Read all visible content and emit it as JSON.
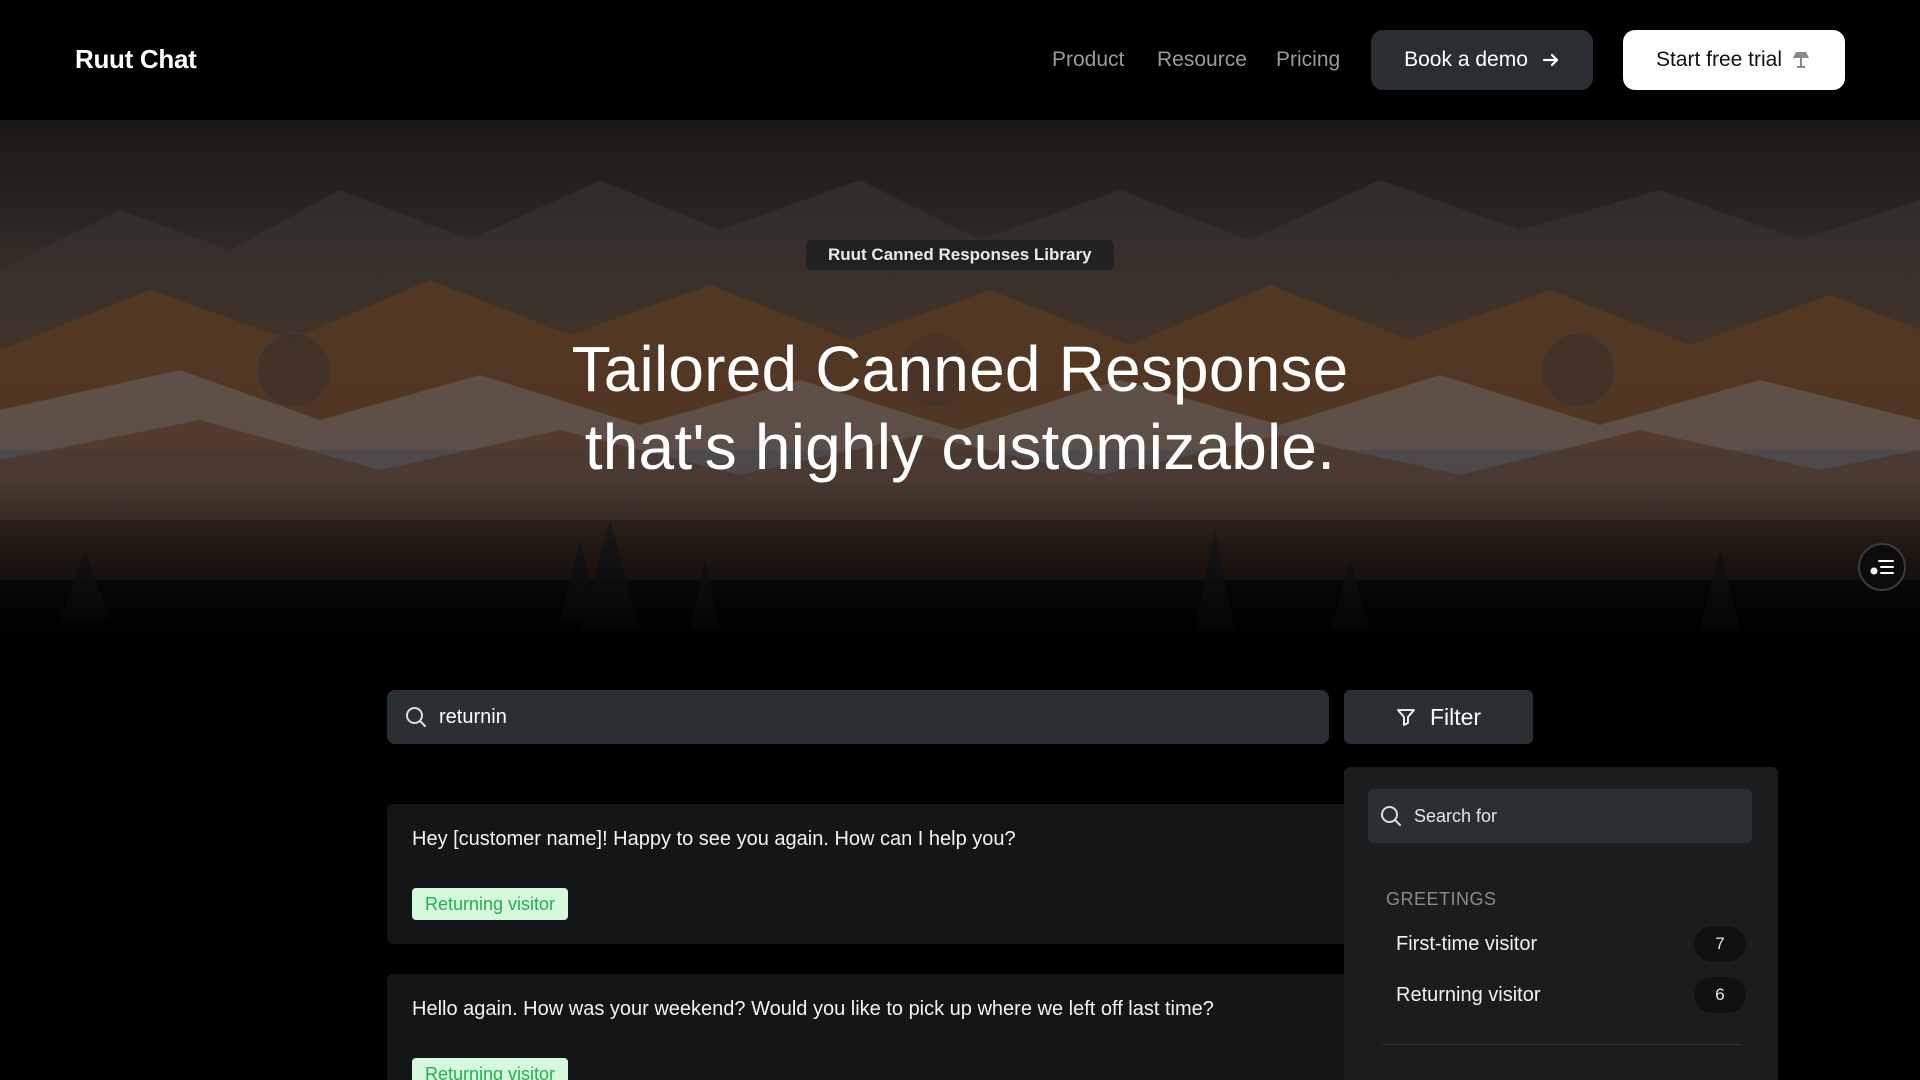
{
  "nav": {
    "brand": "Ruut Chat",
    "links": [
      "Product",
      "Resource",
      "Pricing"
    ],
    "demo_label": "Book a demo",
    "trial_label": "Start free trial"
  },
  "hero": {
    "badge": "Ruut Canned Responses Library",
    "title_line1": "Tailored Canned Response",
    "title_line2": "that's highly customizable."
  },
  "search": {
    "value": "returnin"
  },
  "filter": {
    "label": "Filter",
    "search_placeholder": "Search for",
    "group": "GREETINGS",
    "items": [
      {
        "label": "First-time visitor",
        "count": "7"
      },
      {
        "label": "Returning visitor",
        "count": "6"
      }
    ]
  },
  "results": [
    {
      "text": "Hey [customer name]! Happy to see you again. How can I help you?",
      "tag": "Returning visitor"
    },
    {
      "text": "Hello again. How was your weekend? Would you like to pick up where we left off last time?",
      "tag": "Returning visitor"
    }
  ],
  "colors": {
    "tag_bg": "#d6f8dc",
    "tag_text": "#22b050",
    "input_bg": "#2b2e33"
  }
}
